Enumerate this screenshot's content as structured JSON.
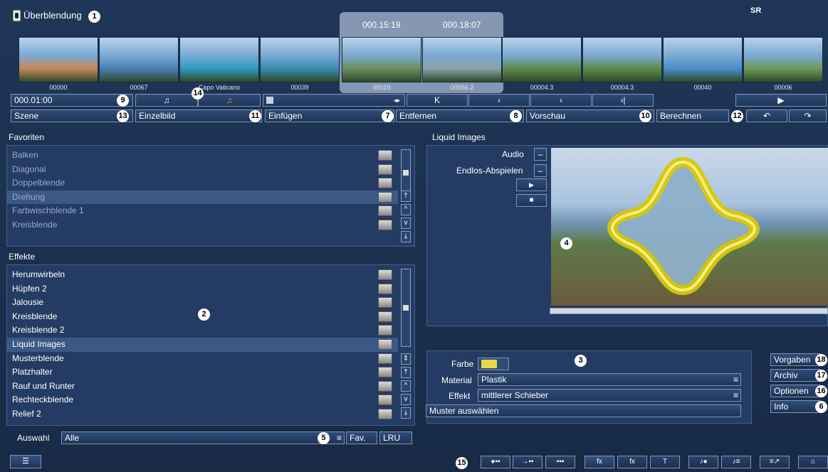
{
  "window": {
    "title": "Überblendung",
    "logo": "SR"
  },
  "badges": {
    "b1": "1",
    "b2": "2",
    "b3": "3",
    "b4": "4",
    "b5": "5",
    "b6": "6",
    "b7": "7",
    "b8": "8",
    "b9": "9",
    "b10": "10",
    "b11": "11",
    "b12": "12",
    "b13": "13",
    "b14": "14",
    "b15": "15",
    "b16": "16",
    "b17": "17",
    "b18": "18"
  },
  "timeline": {
    "time_left": "000.15:19",
    "time_right": "000.18:07",
    "thumbnails": [
      {
        "label": "00000",
        "color": "#c7885a"
      },
      {
        "label": "00067",
        "color": "#4d7fb5"
      },
      {
        "label": "Capo Vaticano",
        "color": "#2f9bc2"
      },
      {
        "label": "00039",
        "color": "#3a8bb0"
      },
      {
        "label": "00019",
        "color": "#6b8f5e"
      },
      {
        "label": "00056.2",
        "color": "#8aa1a8"
      },
      {
        "label": "00004.3",
        "color": "#5f8a4b"
      },
      {
        "label": "00004.3",
        "color": "#5f8a4b"
      },
      {
        "label": "00040",
        "color": "#4a8fc8"
      },
      {
        "label": "00006",
        "color": "#6e9a56"
      }
    ]
  },
  "toolbar": {
    "timecode": "000.01:00",
    "scene_label": "Szene",
    "single_frame_label": "Einzelbild",
    "insert_label": "Einfügen",
    "remove_label": "Entfernen",
    "preview_label": "Vorschau",
    "calculate_label": "Berechnen",
    "nav_first": "K",
    "nav_prev": "‹",
    "nav_next": "›",
    "nav_last": "›|",
    "play": "▶",
    "undo": "↶",
    "redo": "↷",
    "audio1": "♫",
    "audio2": "♫",
    "arrow_lr": "◂▸"
  },
  "favorites": {
    "heading": "Favoriten",
    "items": [
      "Balken",
      "Diagonal",
      "Doppelblende",
      "Drehung",
      "Farbwischblende 1",
      "Kreisblende"
    ],
    "selected_index": 3
  },
  "effects": {
    "heading": "Effekte",
    "items": [
      "Herumwirbeln",
      "Hüpfen 2",
      "Jalousie",
      "Kreisblende",
      "Kreisblende 2",
      "Liquid Images",
      "Musterblende",
      "Platzhalter",
      "Rauf und Runter",
      "Rechteckblende",
      "Relief 2"
    ],
    "selected_index": 5
  },
  "selection": {
    "label": "Auswahl",
    "value": "Alle",
    "fav_label": "Fav.",
    "lru_label": "LRU"
  },
  "preview": {
    "heading": "Liquid Images",
    "audio_label": "Audio",
    "loop_label": "Endlos-Abspielen",
    "toggle_symbol": "–",
    "play": "▶",
    "stop": "■"
  },
  "settings": {
    "color_label": "Farbe",
    "color_value": "#e6d84a",
    "material_label": "Material",
    "material_value": "Plastik",
    "effect_label": "Effekt",
    "effect_value": "mittlerer Schieber",
    "pattern_button": "Muster auswählen"
  },
  "side_buttons": {
    "presets": "Vorgaben",
    "archive": "Archiv",
    "options": "Optionen",
    "info": "Info"
  },
  "scroll": {
    "up": "^",
    "down": "v",
    "top": "⤒",
    "bottom": "⤓",
    "mid": "⇕"
  },
  "bottom_tools": [
    "●▪▪",
    "→▪▪",
    "▪▪▪",
    "fx",
    "fx",
    "T",
    "♪●",
    "♪≡",
    "≡↗",
    "⌂"
  ]
}
